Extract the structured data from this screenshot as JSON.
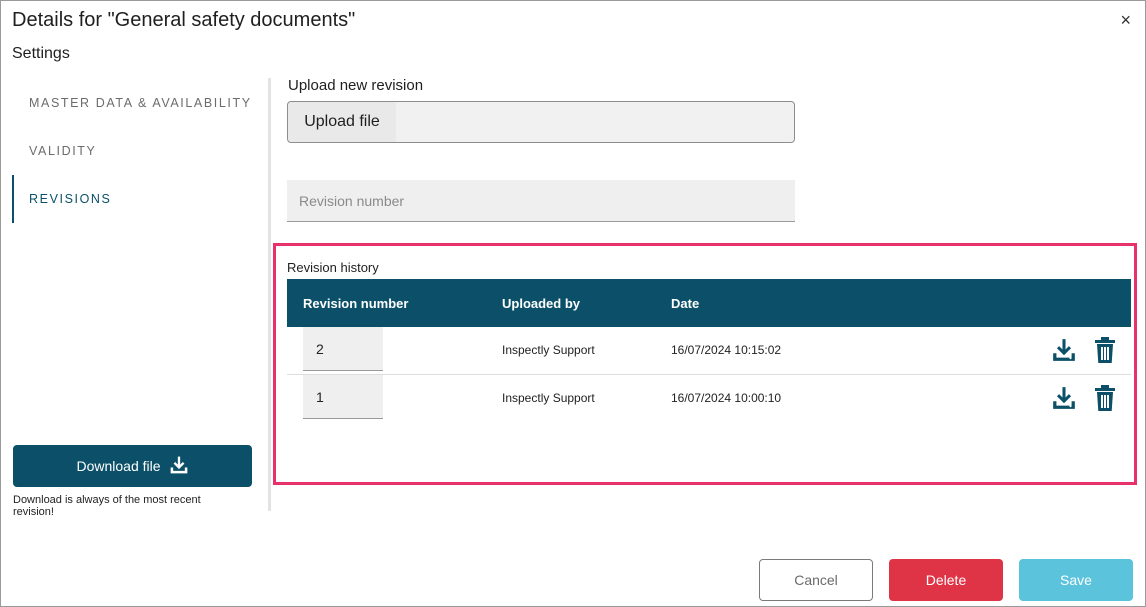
{
  "dialog": {
    "title": "Details for \"General safety documents\"",
    "close_icon": "×",
    "subtitle": "Settings"
  },
  "nav": {
    "items": [
      {
        "label": "MASTER DATA & AVAILABILITY",
        "active": false
      },
      {
        "label": "VALIDITY",
        "active": false
      },
      {
        "label": "REVISIONS",
        "active": true
      }
    ]
  },
  "download": {
    "button_label": "Download file",
    "icon": "download-icon",
    "note": "Download is always of the most recent revision!"
  },
  "upload": {
    "label": "Upload new revision",
    "button_label": "Upload file",
    "file_value": ""
  },
  "revision_input": {
    "placeholder": "Revision number",
    "value": ""
  },
  "history": {
    "label": "Revision history",
    "columns": [
      "Revision number",
      "Uploaded by",
      "Date"
    ],
    "rows": [
      {
        "revision": "2",
        "uploaded_by": "Inspectly Support",
        "date": "16/07/2024 10:15:02"
      },
      {
        "revision": "1",
        "uploaded_by": "Inspectly Support",
        "date": "16/07/2024 10:00:10"
      }
    ],
    "row_icons": [
      "download-icon",
      "trash-icon"
    ]
  },
  "footer": {
    "cancel_label": "Cancel",
    "delete_label": "Delete",
    "save_label": "Save"
  },
  "colors": {
    "primary": "#0b5068",
    "danger": "#df3346",
    "save": "#5bc3dc",
    "highlight": "#e8306a"
  }
}
